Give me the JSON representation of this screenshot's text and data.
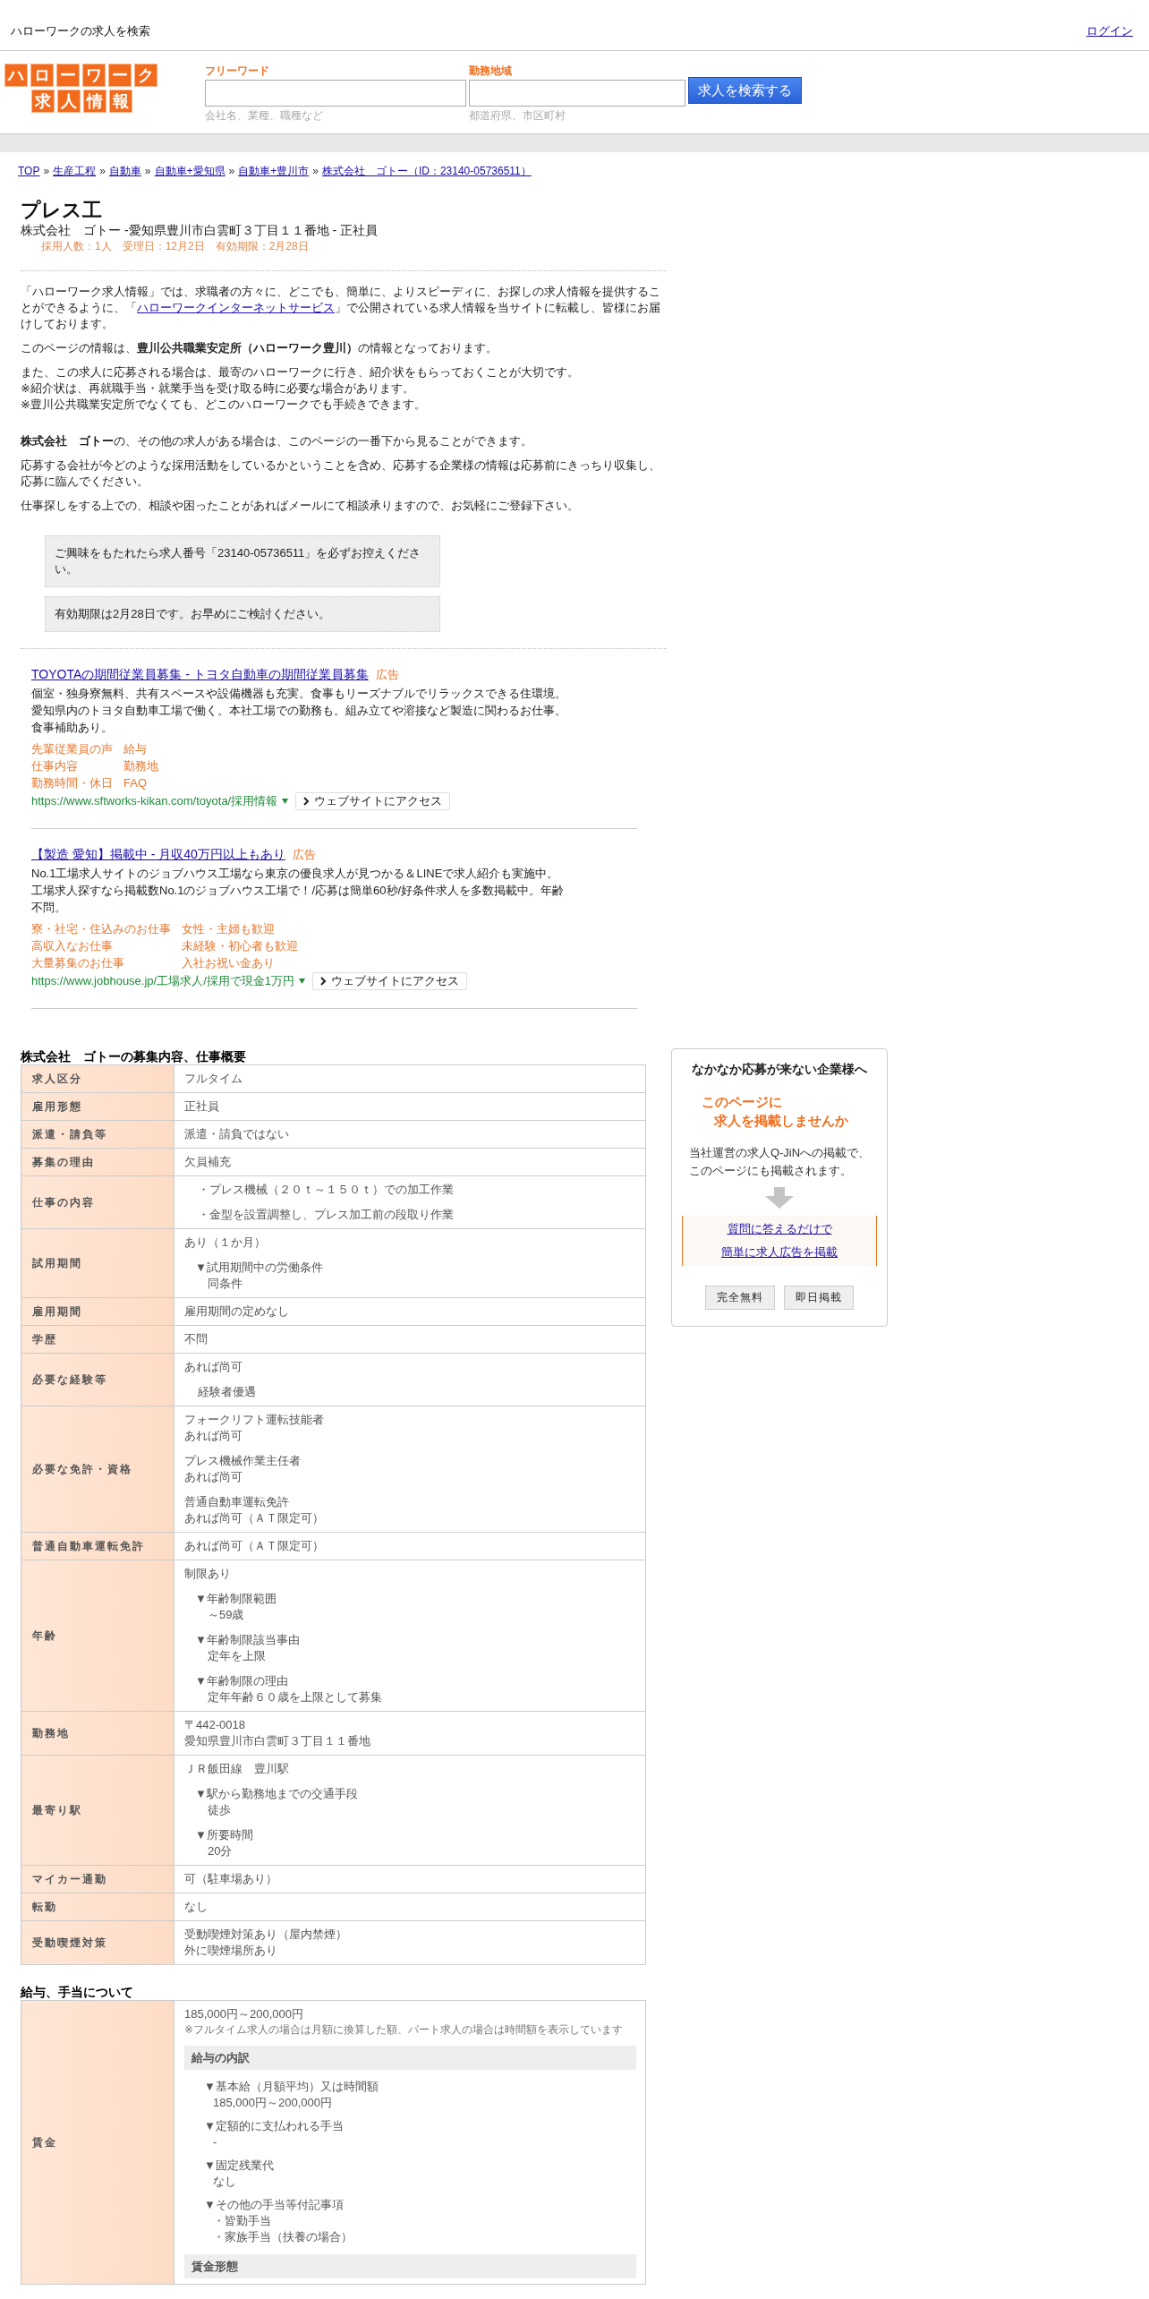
{
  "header": {
    "site_title": "ハローワークの求人を検索",
    "login": "ログイン"
  },
  "logo": {
    "top": [
      "ハ",
      "ロ",
      "ー",
      "ワ",
      "ー",
      "ク"
    ],
    "bottom": [
      "求",
      "人",
      "情",
      "報"
    ]
  },
  "search": {
    "fields": [
      {
        "label": "フリーワード",
        "hint": "会社名、業種、職種など"
      },
      {
        "label": "勤務地域",
        "hint": "都道府県、市区町村"
      }
    ],
    "button": "求人を検索する"
  },
  "breadcrumb": [
    {
      "kind": "link",
      "text": "TOP"
    },
    {
      "kind": "sep",
      "text": "»"
    },
    {
      "kind": "link",
      "text": "生産工程"
    },
    {
      "kind": "sep",
      "text": "»"
    },
    {
      "kind": "link",
      "text": "自動車"
    },
    {
      "kind": "sep",
      "text": "»"
    },
    {
      "kind": "link",
      "text": "自動車+愛知県"
    },
    {
      "kind": "sep",
      "text": "»"
    },
    {
      "kind": "link",
      "text": "自動車+豊川市"
    },
    {
      "kind": "sep",
      "text": "»"
    },
    {
      "kind": "link",
      "text": "株式会社　ゴトー（ID：23140-05736511）"
    }
  ],
  "job": {
    "title": "プレス工",
    "subtitle": "株式会社　ゴトー -愛知県豊川市白雲町３丁目１１番地 - 正社員",
    "meta": "採用人数：1人　受理日：12月2日　有効期限：2月28日"
  },
  "intro": [
    {
      "kind": "link",
      "before": "「ハローワーク求人情報」では、求職者の方々に、どこでも、簡単に、よりスピーディに、お探しの求人情報を提供することができるように、「",
      "link": "ハローワークインターネットサービス",
      "after": "」で公開されている求人情報を当サイトに転載し、皆様にお届けしております。"
    },
    {
      "kind": "lines",
      "lines": [
        "このページの情報は、**豊川公共職業安定所（ハローワーク豊川）**の情報となっております。"
      ]
    },
    {
      "kind": "lines",
      "lines": [
        "また、この求人に応募される場合は、最寄のハローワークに行き、紹介状をもらっておくことが大切です。",
        "※紹介状は、再就職手当・就業手当を受け取る時に必要な場合があります。",
        "※豊川公共職業安定所でなくても、どこのハローワークでも手続きできます。"
      ]
    }
  ],
  "company_note": [
    {
      "kind": "lines",
      "lines": [
        "**株式会社　ゴトー**の、その他の求人がある場合は、このページの一番下から見ることができます。"
      ]
    },
    {
      "kind": "lines",
      "lines": [
        "応募する会社が今どのような採用活動をしているかということを含め、応募する企業様の情報は応募前にきっちり収集し、応募に臨んでください。"
      ]
    },
    {
      "kind": "lines",
      "lines": [
        "仕事探しをする上での、相談や困ったことがあればメールにて相談承りますので、お気軽にご登録下さい。"
      ]
    }
  ],
  "notices": [
    "ご興味をもたれたら求人番号「23140-05736511」を必ずお控えください。",
    "有効期限は2月28日です。お早めにご検討ください。"
  ],
  "ads": [
    {
      "title": "TOYOTAの期間従業員募集 - トヨタ自動車の期間従業員募集",
      "badge": "広告",
      "description": "個室・独身寮無料、共有スペースや設備機器も充実。食事もリーズナブルでリラックスできる住環境。愛知県内のトヨタ自動車工場で働く。本社工場での勤務も。組み立てや溶接など製造に関わるお仕事。食事補助あり。",
      "links": [
        "先輩従業員の声",
        "給与",
        "仕事内容",
        "勤務地",
        "勤務時間・休日",
        "FAQ"
      ],
      "url": "https://www.sftworks-kikan.com/toyota/採用情報",
      "button": "ウェブサイトにアクセス"
    },
    {
      "title": "【製造 愛知】掲載中 - 月収40万円以上もあり",
      "badge": "広告",
      "description": "No.1工場求人サイトのジョブハウス工場なら東京の優良求人が見つかる＆LINEで求人紹介も実施中。工場求人探すなら掲載数No.1のジョブハウス工場で！/応募は簡単60秒/好条件求人を多数掲載中。年齢不問。",
      "links": [
        "寮・社宅・住込みのお仕事",
        "女性・主婦も歓迎",
        "高収入なお仕事",
        "未経験・初心者も歓迎",
        "大量募集のお仕事",
        "入社お祝い金あり"
      ],
      "url": "https://www.jobhouse.jp/工場求人/採用で現金1万円",
      "button": "ウェブサイトにアクセス"
    }
  ],
  "overview": {
    "title": "株式会社　ゴトーの募集内容、仕事概要",
    "rows": [
      {
        "label": "求人区分",
        "blocks": [
          {
            "kind": "plain",
            "lines": [
              "フルタイム"
            ]
          }
        ]
      },
      {
        "label": "雇用形態",
        "blocks": [
          {
            "kind": "plain",
            "lines": [
              "正社員"
            ]
          }
        ]
      },
      {
        "label": "派遣・請負等",
        "blocks": [
          {
            "kind": "plain",
            "lines": [
              "派遣・請負ではない"
            ]
          }
        ]
      },
      {
        "label": "募集の理由",
        "blocks": [
          {
            "kind": "plain",
            "lines": [
              "欠員補充"
            ]
          }
        ]
      },
      {
        "label": "仕事の内容",
        "blocks": [
          {
            "kind": "indent",
            "lines": [
              "・プレス機械（２０ｔ～１５０ｔ）での加工作業"
            ]
          },
          {
            "kind": "indent",
            "lines": [
              "・金型を設置調整し、プレス加工前の段取り作業"
            ]
          }
        ]
      },
      {
        "label": "試用期間",
        "blocks": [
          {
            "kind": "plain",
            "lines": [
              "あり（１か月）"
            ]
          },
          {
            "kind": "sub",
            "heading": "▼試用期間中の労働条件",
            "lines": [
              "同条件"
            ]
          }
        ]
      },
      {
        "label": "雇用期間",
        "blocks": [
          {
            "kind": "plain",
            "lines": [
              "雇用期間の定めなし"
            ]
          }
        ]
      },
      {
        "label": "学歴",
        "blocks": [
          {
            "kind": "plain",
            "lines": [
              "不問"
            ]
          }
        ]
      },
      {
        "label": "必要な経験等",
        "blocks": [
          {
            "kind": "plain",
            "lines": [
              "あれば尚可"
            ]
          },
          {
            "kind": "indent",
            "lines": [
              "経験者優遇"
            ]
          }
        ]
      },
      {
        "label": "必要な免許・資格",
        "blocks": [
          {
            "kind": "plain",
            "lines": [
              "フォークリフト運転技能者",
              "あれば尚可"
            ]
          },
          {
            "kind": "plain",
            "lines": [
              "プレス機械作業主任者",
              "あれば尚可"
            ]
          },
          {
            "kind": "plain",
            "lines": [
              "普通自動車運転免許",
              "あれば尚可（ＡＴ限定可）"
            ]
          }
        ]
      },
      {
        "label": "普通自動車運転免許",
        "blocks": [
          {
            "kind": "plain",
            "lines": [
              "あれば尚可（ＡＴ限定可）"
            ]
          }
        ]
      },
      {
        "label": "年齢",
        "blocks": [
          {
            "kind": "plain",
            "lines": [
              "制限あり"
            ]
          },
          {
            "kind": "sub",
            "heading": "▼年齢制限範囲",
            "lines": [
              "～59歳"
            ]
          },
          {
            "kind": "sub",
            "heading": "▼年齢制限該当事由",
            "lines": [
              "定年を上限"
            ]
          },
          {
            "kind": "sub",
            "heading": "▼年齢制限の理由",
            "lines": [
              "定年年齢６０歳を上限として募集"
            ]
          }
        ]
      },
      {
        "label": "勤務地",
        "blocks": [
          {
            "kind": "plain",
            "lines": [
              "〒442-0018",
              "愛知県豊川市白雲町３丁目１１番地"
            ]
          }
        ]
      },
      {
        "label": "最寄り駅",
        "blocks": [
          {
            "kind": "plain",
            "lines": [
              "ＪＲ飯田線　豊川駅"
            ]
          },
          {
            "kind": "sub",
            "heading": "▼駅から勤務地までの交通手段",
            "lines": [
              "徒歩"
            ]
          },
          {
            "kind": "sub",
            "heading": "▼所要時間",
            "lines": [
              "20分"
            ]
          }
        ]
      },
      {
        "label": "マイカー通勤",
        "blocks": [
          {
            "kind": "plain",
            "lines": [
              "可（駐車場あり）"
            ]
          }
        ]
      },
      {
        "label": "転勤",
        "blocks": [
          {
            "kind": "plain",
            "lines": [
              "なし"
            ]
          }
        ]
      },
      {
        "label": "受動喫煙対策",
        "blocks": [
          {
            "kind": "plain",
            "lines": [
              "受動喫煙対策あり（屋内禁煙）",
              "外に喫煙場所あり"
            ]
          }
        ]
      }
    ]
  },
  "salary": {
    "title": "給与、手当について",
    "rows": [
      {
        "label": "賃金",
        "blocks": [
          {
            "kind": "plain",
            "lines": [
              "185,000円～200,000円"
            ]
          },
          {
            "kind": "note",
            "lines": [
              "※フルタイム求人の場合は月額に換算した額、パート求人の場合は時間額を表示しています"
            ]
          },
          {
            "kind": "heading",
            "lines": [
              "給与の内訳"
            ]
          },
          {
            "kind": "deep",
            "heading": "▼基本給（月額平均）又は時間額",
            "lines": [
              "185,000円～200,000円"
            ]
          },
          {
            "kind": "deep",
            "heading": "▼定額的に支払われる手当",
            "lines": [
              "-"
            ]
          },
          {
            "kind": "deep",
            "heading": "▼固定残業代",
            "lines": [
              "なし"
            ]
          },
          {
            "kind": "deep",
            "heading": "▼その他の手当等付記事項",
            "lines": [
              "・皆勤手当",
              "・家族手当（扶養の場合）"
            ]
          },
          {
            "kind": "heading",
            "lines": [
              "賃金形態"
            ]
          }
        ]
      }
    ]
  },
  "promo": {
    "title": "なかなか応募が来ない企業様へ",
    "catch": [
      "このページに",
      "求人を掲載しませんか"
    ],
    "description": [
      "当社運営の求人Q-JiNへの掲載で、",
      "このページにも掲載されます。"
    ],
    "links": [
      "質問に答えるだけで",
      "簡単に求人広告を掲載"
    ],
    "tags": [
      "完全無料",
      "即日掲載"
    ]
  }
}
